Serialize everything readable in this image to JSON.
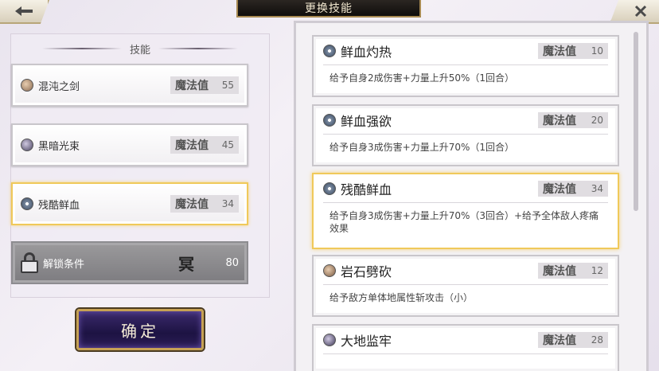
{
  "header": {
    "title": "更换技能",
    "back_icon": "arrow-left-icon",
    "close_icon": "close-icon"
  },
  "left": {
    "heading": "技能",
    "slots": [
      {
        "name": "混沌之剑",
        "mana_label": "魔法值",
        "mana": "55",
        "icon": "sword-orb-icon"
      },
      {
        "name": "黑暗光束",
        "mana_label": "魔法值",
        "mana": "45",
        "icon": "dark-orb-icon"
      },
      {
        "name": "残酷鲜血",
        "mana_label": "魔法值",
        "mana": "34",
        "icon": "blood-orb-icon"
      }
    ],
    "locked": {
      "name": "解锁条件",
      "requirement_icon": "冥",
      "value": "80"
    },
    "confirm": "确定"
  },
  "skills": [
    {
      "name": "鲜血灼热",
      "mana_label": "魔法值",
      "mana": "10",
      "desc": "给予自身2成伤害+力量上升50%（1回合）"
    },
    {
      "name": "鲜血强欲",
      "mana_label": "魔法值",
      "mana": "20",
      "desc": "给予自身3成伤害+力量上升70%（1回合）"
    },
    {
      "name": "残酷鲜血",
      "mana_label": "魔法值",
      "mana": "34",
      "desc": "给予自身3成伤害+力量上升70%（3回合）+给予全体敌人疼痛效果"
    },
    {
      "name": "岩石劈砍",
      "mana_label": "魔法值",
      "mana": "12",
      "desc": "给予敌方单体地属性斩攻击（小）"
    },
    {
      "name": "大地监牢",
      "mana_label": "魔法值",
      "mana": "28",
      "desc": ""
    }
  ],
  "colors": {
    "selected_border": "#f0c95a",
    "confirm_bg": "#2b1d56"
  }
}
